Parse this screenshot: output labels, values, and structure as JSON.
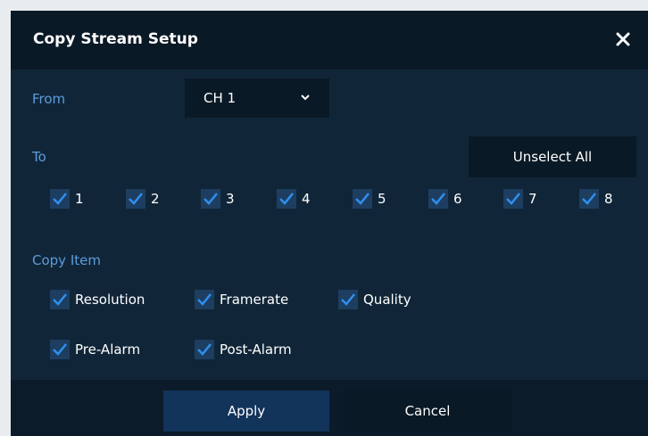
{
  "dialog": {
    "title": "Copy Stream Setup",
    "close_icon": "close-icon"
  },
  "from": {
    "label": "From",
    "selected": "CH 1",
    "icon": "chevron-down-icon"
  },
  "to": {
    "label": "To",
    "unselect_label": "Unselect All",
    "channels": [
      {
        "label": "1",
        "checked": true
      },
      {
        "label": "2",
        "checked": true
      },
      {
        "label": "3",
        "checked": true
      },
      {
        "label": "4",
        "checked": true
      },
      {
        "label": "5",
        "checked": true
      },
      {
        "label": "6",
        "checked": true
      },
      {
        "label": "7",
        "checked": true
      },
      {
        "label": "8",
        "checked": true
      }
    ]
  },
  "copy_item": {
    "label": "Copy Item",
    "items": [
      {
        "label": "Resolution",
        "checked": true
      },
      {
        "label": "Framerate",
        "checked": true
      },
      {
        "label": "Quality",
        "checked": true
      },
      {
        "label": "Pre-Alarm",
        "checked": true
      },
      {
        "label": "Post-Alarm",
        "checked": true
      }
    ]
  },
  "footer": {
    "apply_label": "Apply",
    "cancel_label": "Cancel"
  },
  "colors": {
    "background": "#102638",
    "titlebar": "#0a1926",
    "accent_text": "#5d9bdc",
    "check": "#2f8ff0"
  }
}
